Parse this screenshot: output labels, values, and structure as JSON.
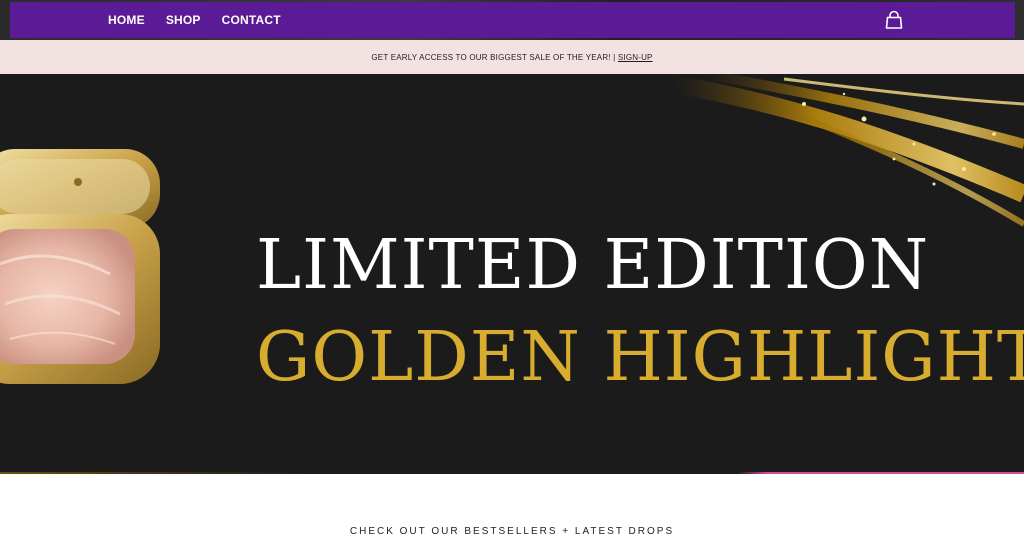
{
  "nav": {
    "items": [
      {
        "label": "HOME"
      },
      {
        "label": "SHOP"
      },
      {
        "label": "CONTACT"
      }
    ],
    "cart_icon": "shopping-bag-icon",
    "background": "#5b1a96"
  },
  "announcement": {
    "text": "GET EARLY ACCESS TO OUR BIGGEST SALE OF THE YEAR! | ",
    "link": "SIGN-UP",
    "background": "#f2e3e2"
  },
  "hero": {
    "line1": "LIMITED EDITION",
    "line2": "GOLDEN HIGHLIGHTER",
    "accent_color": "#d8ac2e",
    "background": "#1b1b1b"
  },
  "bestsellers": {
    "heading": "CHECK OUT OUR BESTSELLERS + LATEST DROPS"
  }
}
